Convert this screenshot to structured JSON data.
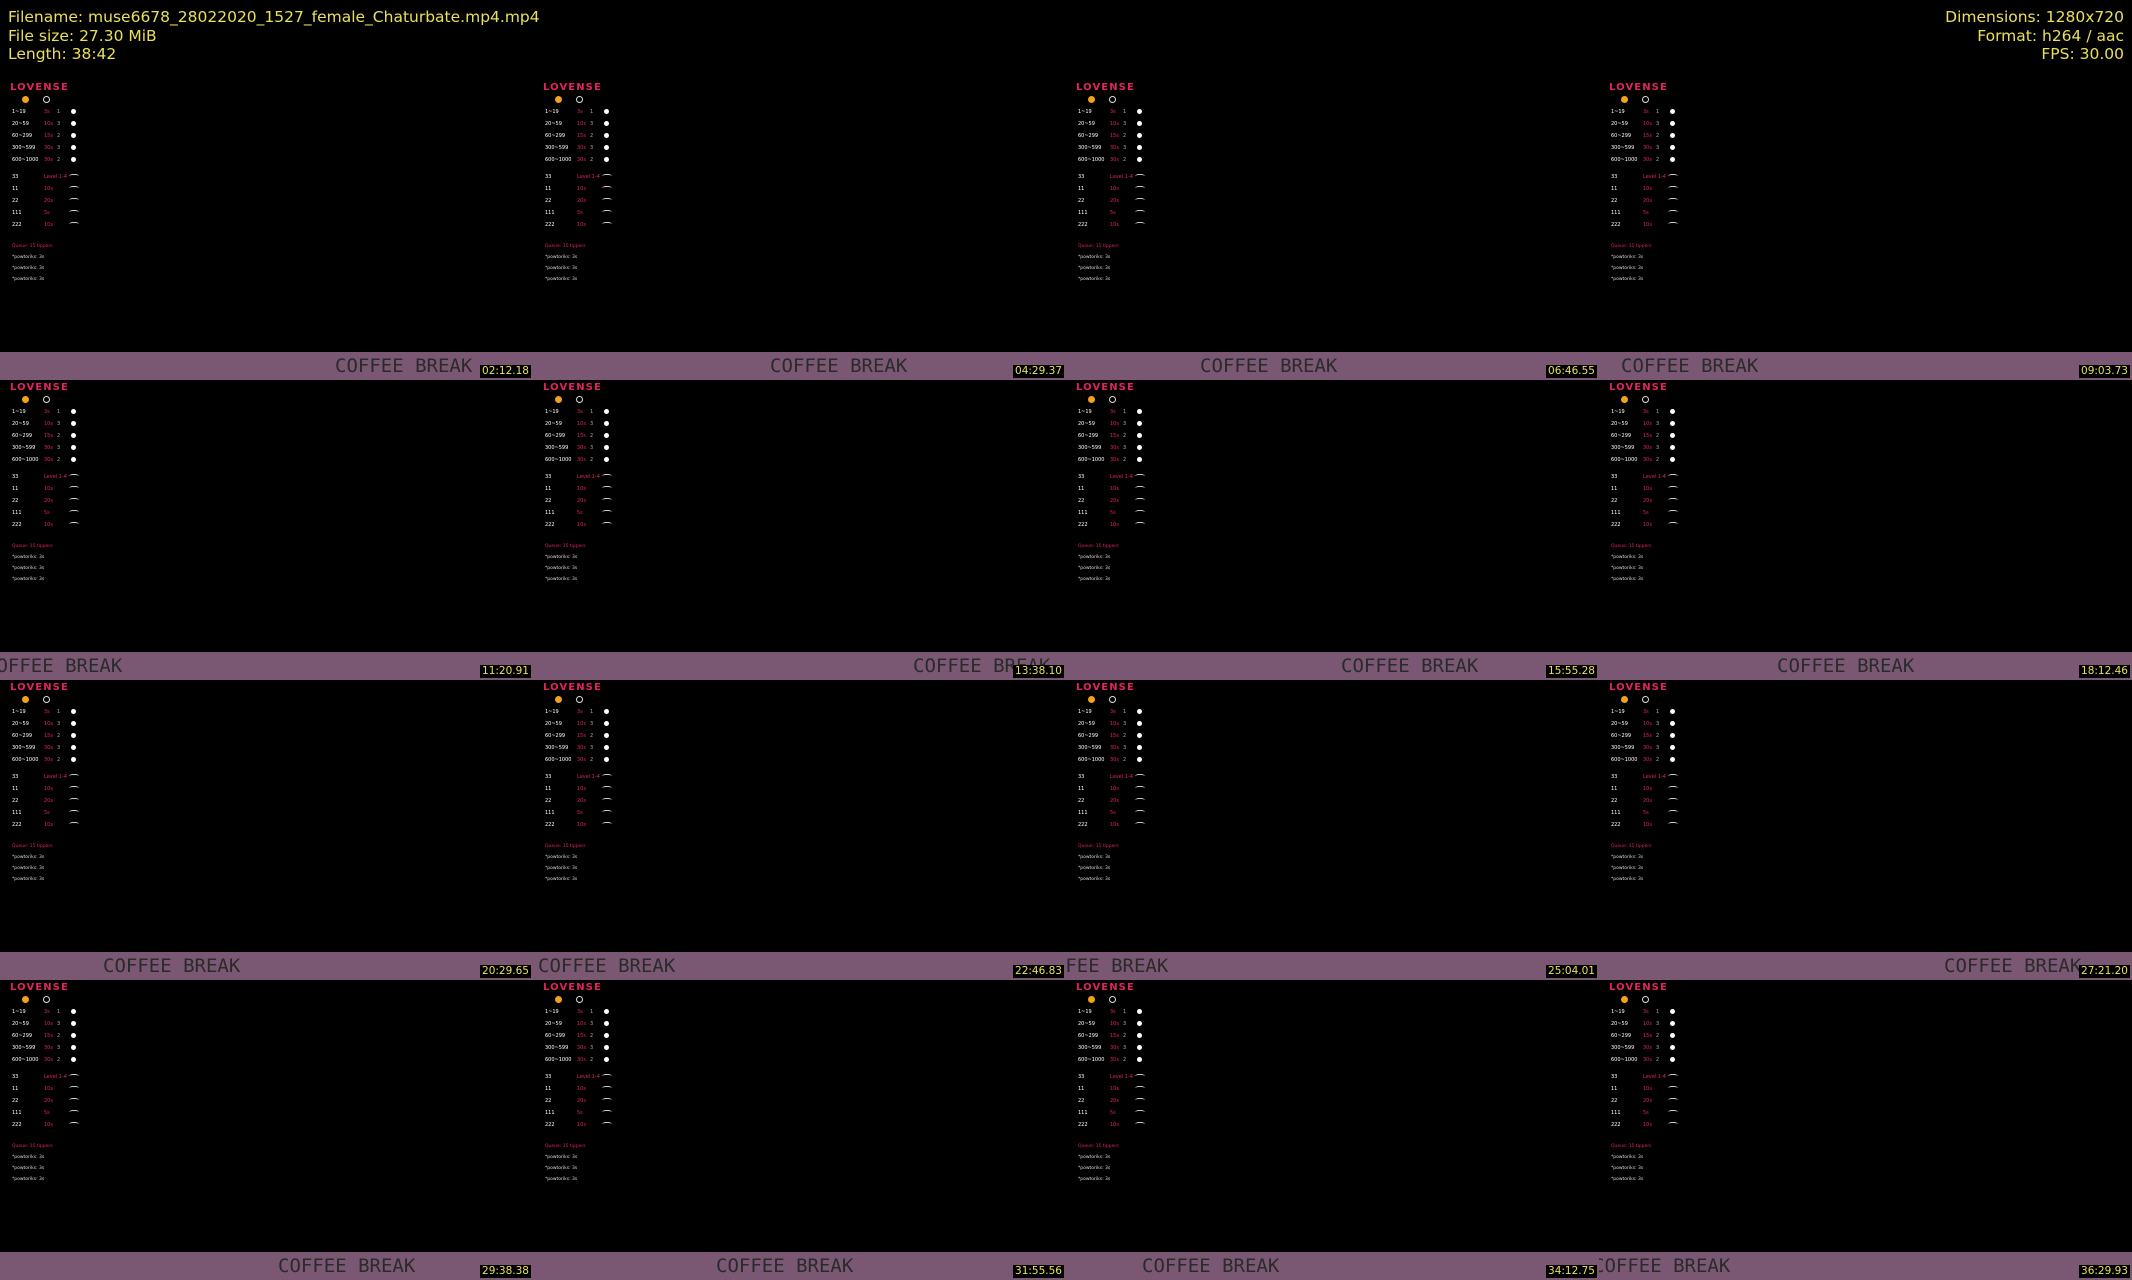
{
  "header": {
    "filename": "Filename: muse6678_28022020_1527_female_Chaturbate.mp4.mp4",
    "filesize": "File size: 27.30 MiB",
    "length": "Length: 38:42",
    "dimensions": "Dimensions: 1280x720",
    "format": "Format: h264 / aac",
    "fps": "FPS: 30.00"
  },
  "overlay": {
    "logo": "LOVENSE",
    "rows": [
      {
        "a": "1~19",
        "b": "3s",
        "c": "1"
      },
      {
        "a": "20~59",
        "b": "10s",
        "c": "3"
      },
      {
        "a": "60~299",
        "b": "15s",
        "c": "2"
      },
      {
        "a": "300~599",
        "b": "30s",
        "c": "3"
      },
      {
        "a": "600~1000",
        "b": "30s",
        "c": "2"
      }
    ],
    "special": [
      {
        "a": "33",
        "b": "Level 1-4"
      },
      {
        "a": "11",
        "b": "10s"
      },
      {
        "a": "22",
        "b": "20s"
      },
      {
        "a": "111",
        "b": "5s"
      },
      {
        "a": "222",
        "b": "10s"
      }
    ],
    "queue_title": "Queue: 15 tippers",
    "queue": [
      "*powtoriks: 3s",
      "*powtoriks: 3s",
      "*powtoriks: 3s"
    ]
  },
  "band_text": "COFFEE BREAK",
  "thumbnails": [
    {
      "time": "02:12.18",
      "cb": 335
    },
    {
      "time": "04:29.37",
      "cb": 237
    },
    {
      "time": "06:46.55",
      "cb": 134
    },
    {
      "time": "09:03.73",
      "cb": 22
    },
    {
      "time": "11:20.91",
      "cb": -15
    },
    {
      "time": "13:38.10",
      "cb": 380
    },
    {
      "time": "15:55.28",
      "cb": 275
    },
    {
      "time": "18:12.46",
      "cb": 178
    },
    {
      "time": "20:29.65",
      "cb": 103
    },
    {
      "time": "22:46.83",
      "cb": 5
    },
    {
      "time": "25:04.01",
      "cb": -35
    },
    {
      "time": "27:21.20",
      "cb": 345
    },
    {
      "time": "29:38.38",
      "cb": 278
    },
    {
      "time": "31:55.56",
      "cb": 183
    },
    {
      "time": "34:12.75",
      "cb": 76
    },
    {
      "time": "36:29.93",
      "cb": -6
    }
  ]
}
